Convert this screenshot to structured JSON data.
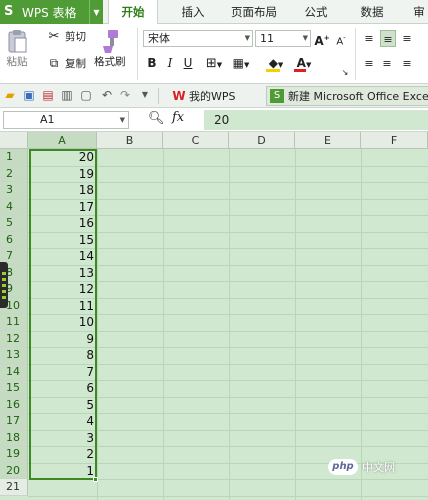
{
  "app": {
    "title": "WPS 表格",
    "logo": "S"
  },
  "menu": {
    "tabs": [
      {
        "label": "开始",
        "active": true
      },
      {
        "label": "插入"
      },
      {
        "label": "页面布局"
      },
      {
        "label": "公式"
      },
      {
        "label": "数据"
      },
      {
        "label": "审"
      }
    ]
  },
  "ribbon": {
    "paste": "粘贴",
    "cut": "剪切",
    "copy": "复制",
    "format_painter": "格式刷",
    "font_name": "宋体",
    "font_size": "11",
    "bold": "B",
    "italic": "I",
    "underline": "U"
  },
  "qat": {
    "wps_tab": "我的WPS",
    "doc_tab": "新建 Microsoft Office Excel"
  },
  "formula_bar": {
    "cell_ref": "A1",
    "fx": "fx",
    "value": "20"
  },
  "grid": {
    "columns": [
      "A",
      "B",
      "C",
      "D",
      "E",
      "F"
    ],
    "rows": [
      "1",
      "2",
      "3",
      "4",
      "5",
      "6",
      "7",
      "8",
      "9",
      "10",
      "11",
      "12",
      "13",
      "14",
      "15",
      "16",
      "17",
      "18",
      "19",
      "20",
      "21"
    ],
    "column_a_values": [
      "20",
      "19",
      "18",
      "17",
      "16",
      "15",
      "14",
      "13",
      "12",
      "11",
      "10",
      "9",
      "8",
      "7",
      "6",
      "5",
      "4",
      "3",
      "2",
      "1"
    ]
  },
  "watermark": {
    "logo": "php",
    "text": "中文网"
  },
  "colors": {
    "accent": "#4f9b36",
    "sheet_bg": "#cfe8cf",
    "selection": "#3b8a22"
  }
}
